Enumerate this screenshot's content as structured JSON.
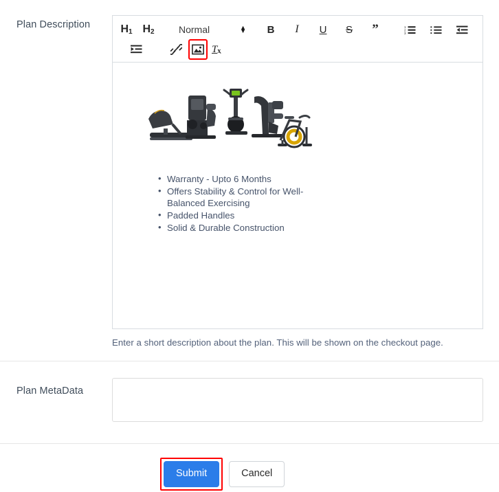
{
  "form": {
    "description_field": {
      "label": "Plan Description",
      "help_text": "Enter a short description about the plan. This will be shown on the checkout page."
    },
    "metadata_field": {
      "label": "Plan MetaData",
      "value": "",
      "placeholder": ""
    }
  },
  "editor": {
    "toolbar": {
      "heading1": {
        "name": "H",
        "sub": "1"
      },
      "heading2": {
        "name": "H",
        "sub": "2"
      },
      "format_select": {
        "value": "Normal"
      },
      "bold": {
        "glyph": "B",
        "title": "Bold"
      },
      "italic": {
        "glyph": "I",
        "title": "Italic"
      },
      "underline": {
        "glyph": "U",
        "title": "Underline"
      },
      "strikethrough": {
        "glyph": "S",
        "title": "Strikethrough"
      },
      "blockquote": {
        "glyph": "”",
        "title": "Blockquote"
      },
      "ordered_list": {
        "title": "Ordered List"
      },
      "bullet_list": {
        "title": "Bullet List"
      },
      "outdent": {
        "title": "Decrease Indent"
      },
      "indent": {
        "title": "Increase Indent"
      },
      "link": {
        "title": "Insert Link"
      },
      "image": {
        "title": "Insert Image",
        "highlighted": true
      },
      "clear_format": {
        "glyph": "T",
        "sub": "x",
        "title": "Clear Formatting"
      }
    },
    "content": {
      "image_alt": "Gym equipment line-up: treadmill, leg press, elliptical, chest press, spin bike",
      "bullets": [
        "Warranty - Upto 6 Months",
        "Offers Stability & Control for Well-Balanced Exercising",
        "Padded Handles",
        "Solid & Durable Construction"
      ]
    }
  },
  "actions": {
    "submit_label": "Submit",
    "cancel_label": "Cancel"
  },
  "colors": {
    "accent_blue": "#2b7de9",
    "highlight_red": "#ff0000",
    "label_text": "#3f4c5a",
    "border_gray": "#d8dce0"
  }
}
